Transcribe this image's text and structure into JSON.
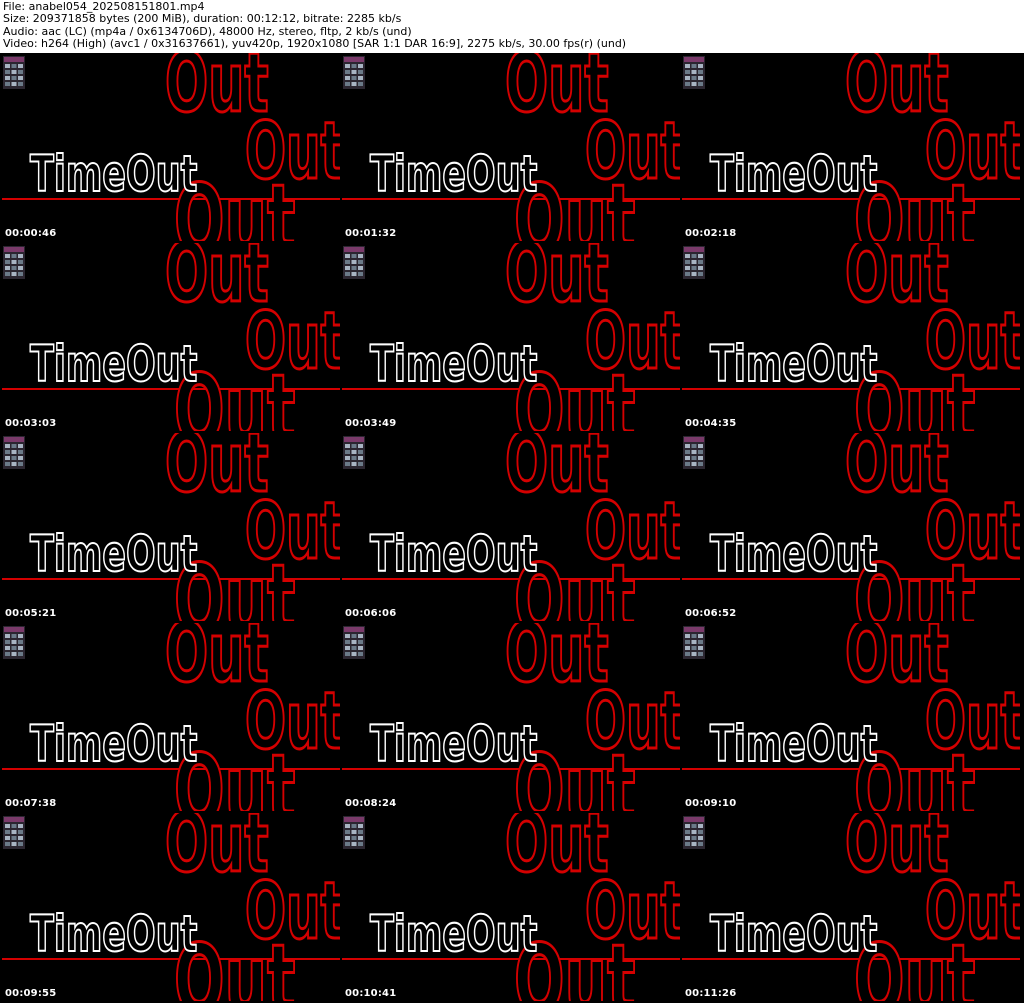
{
  "header": {
    "file": "File: anabel054_202508151801.mp4",
    "size": "Size: 209371858 bytes (200 MiB), duration: 00:12:12, bitrate: 2285 kb/s",
    "audio": "Audio: aac (LC) (mp4a / 0x6134706D), 48000 Hz, stereo, fltp, 2 kb/s (und)",
    "video": "Video: h264 (High) (avc1 / 0x31637661), yuv420p, 1920x1080 [SAR 1:1 DAR 16:9], 2275 kb/s, 30.00 fps(r) (und)"
  },
  "frame": {
    "logo_text": "TimeOut",
    "overlay_word": "Out",
    "logo_color": "#ffffff",
    "accent_color": "#d40000",
    "background": "#000000"
  },
  "thumbnails": [
    {
      "timestamp": "00:00:46"
    },
    {
      "timestamp": "00:01:32"
    },
    {
      "timestamp": "00:02:18"
    },
    {
      "timestamp": "00:03:03"
    },
    {
      "timestamp": "00:03:49"
    },
    {
      "timestamp": "00:04:35"
    },
    {
      "timestamp": "00:05:21"
    },
    {
      "timestamp": "00:06:06"
    },
    {
      "timestamp": "00:06:52"
    },
    {
      "timestamp": "00:07:38"
    },
    {
      "timestamp": "00:08:24"
    },
    {
      "timestamp": "00:09:10"
    },
    {
      "timestamp": "00:09:55"
    },
    {
      "timestamp": "00:10:41"
    },
    {
      "timestamp": "00:11:26"
    }
  ]
}
